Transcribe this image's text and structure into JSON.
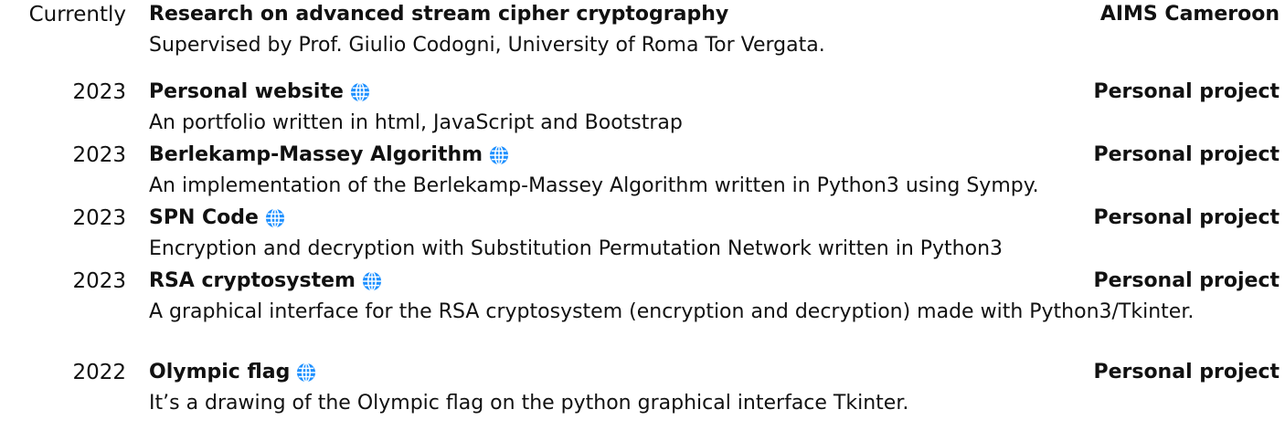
{
  "entries": [
    {
      "date": "Currently",
      "title": "Research on advanced stream cipher cryptography",
      "has_link_icon": false,
      "org": "AIMS Cameroon",
      "description": "Supervised by Prof. Giulio Codogni, University of Roma Tor Vergata."
    },
    {
      "date": "2023",
      "title": "Personal website",
      "has_link_icon": true,
      "org": "Personal project",
      "description": "An portfolio written in html, JavaScript and Bootstrap"
    },
    {
      "date": "2023",
      "title": "Berlekamp-Massey Algorithm",
      "has_link_icon": true,
      "org": "Personal project",
      "description": "An implementation of the Berlekamp-Massey Algorithm written in Python3 using Sympy."
    },
    {
      "date": "2023",
      "title": "SPN Code",
      "has_link_icon": true,
      "org": "Personal project",
      "description": "Encryption and decryption with Substitution Permutation Network written in Python3"
    },
    {
      "date": "2023",
      "title": "RSA cryptosystem",
      "has_link_icon": true,
      "org": "Personal project",
      "description": "A graphical interface for the RSA cryptosystem (encryption and decryption) made with Python3/Tkinter."
    },
    {
      "date": "2022",
      "title": "Olympic flag",
      "has_link_icon": true,
      "org": "Personal project",
      "description": "It’s a drawing of the Olympic flag on the python graphical interface Tkinter."
    }
  ],
  "icon": "globe-icon",
  "colors": {
    "text": "#111111",
    "icon": "#1e90ff"
  }
}
